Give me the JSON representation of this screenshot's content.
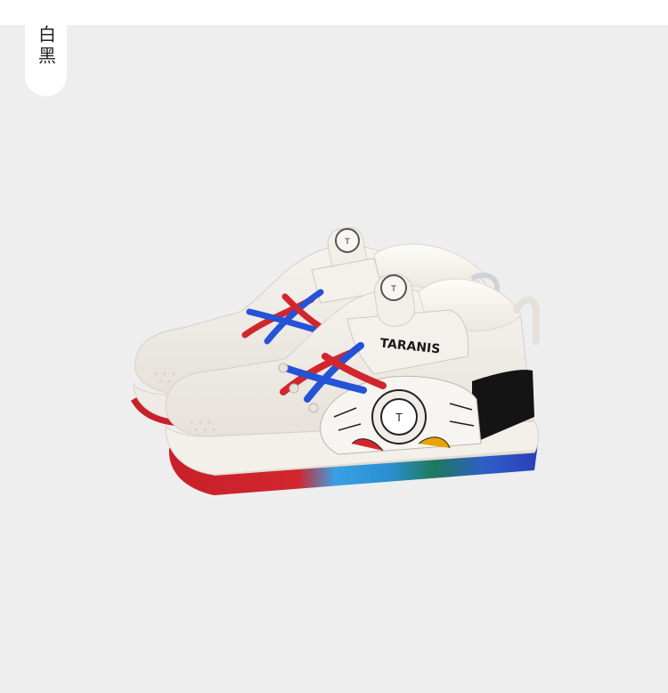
{
  "color_tag": {
    "label": "白黑"
  },
  "product": {
    "brand_text": "TARANIS",
    "colors": {
      "background": "#eeeeef",
      "upper": "#f1ede8",
      "lace_blue": "#2453d6",
      "lace_red": "#d1262e",
      "heel_black": "#141414"
    }
  }
}
